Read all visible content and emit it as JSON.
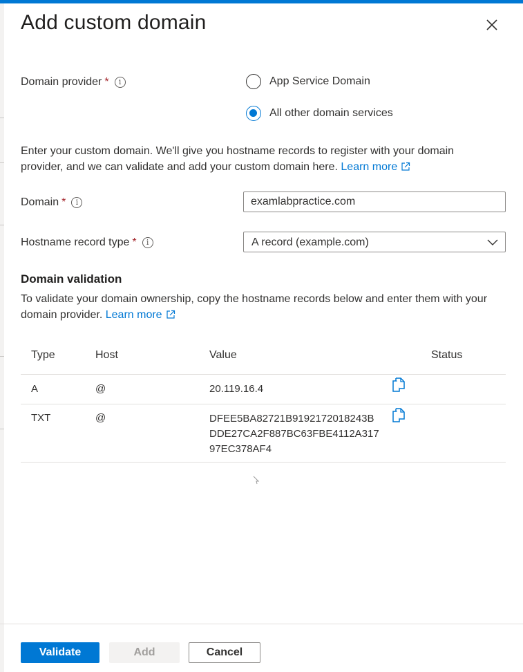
{
  "panel": {
    "title": "Add custom domain",
    "close_icon": "close-icon"
  },
  "domain_provider": {
    "label": "Domain provider",
    "required_mark": "*",
    "info_icon": "info-icon",
    "options": [
      {
        "label": "App Service Domain",
        "selected": false
      },
      {
        "label": "All other domain services",
        "selected": true
      }
    ]
  },
  "intro": {
    "text": "Enter your custom domain. We'll give you hostname records to register with your domain provider, and we can validate and add your custom domain here.",
    "link": "Learn more"
  },
  "domain": {
    "label": "Domain",
    "required_mark": "*",
    "value": "examlabpractice.com"
  },
  "hostname_record_type": {
    "label": "Hostname record type",
    "required_mark": "*",
    "selected": "A record (example.com)"
  },
  "validation": {
    "heading": "Domain validation",
    "text": "To validate your domain ownership, copy the hostname records below and enter them with your domain provider.",
    "link": "Learn more",
    "columns": [
      "Type",
      "Host",
      "Value",
      "Status"
    ],
    "rows": [
      {
        "type": "A",
        "host": "@",
        "value_lines": [
          "20.119.16.4"
        ],
        "status": ""
      },
      {
        "type": "TXT",
        "host": "@",
        "value_lines": [
          "DFEE5BA82721B9192172018243B",
          "DDE27CA2F887BC63FBE4112A317",
          "97EC378AF4"
        ],
        "status": ""
      }
    ]
  },
  "footer": {
    "validate_label": "Validate",
    "add_label": "Add",
    "cancel_label": "Cancel"
  },
  "colors": {
    "accent": "#0078d4",
    "required": "#a4262c",
    "text": "#323130"
  }
}
